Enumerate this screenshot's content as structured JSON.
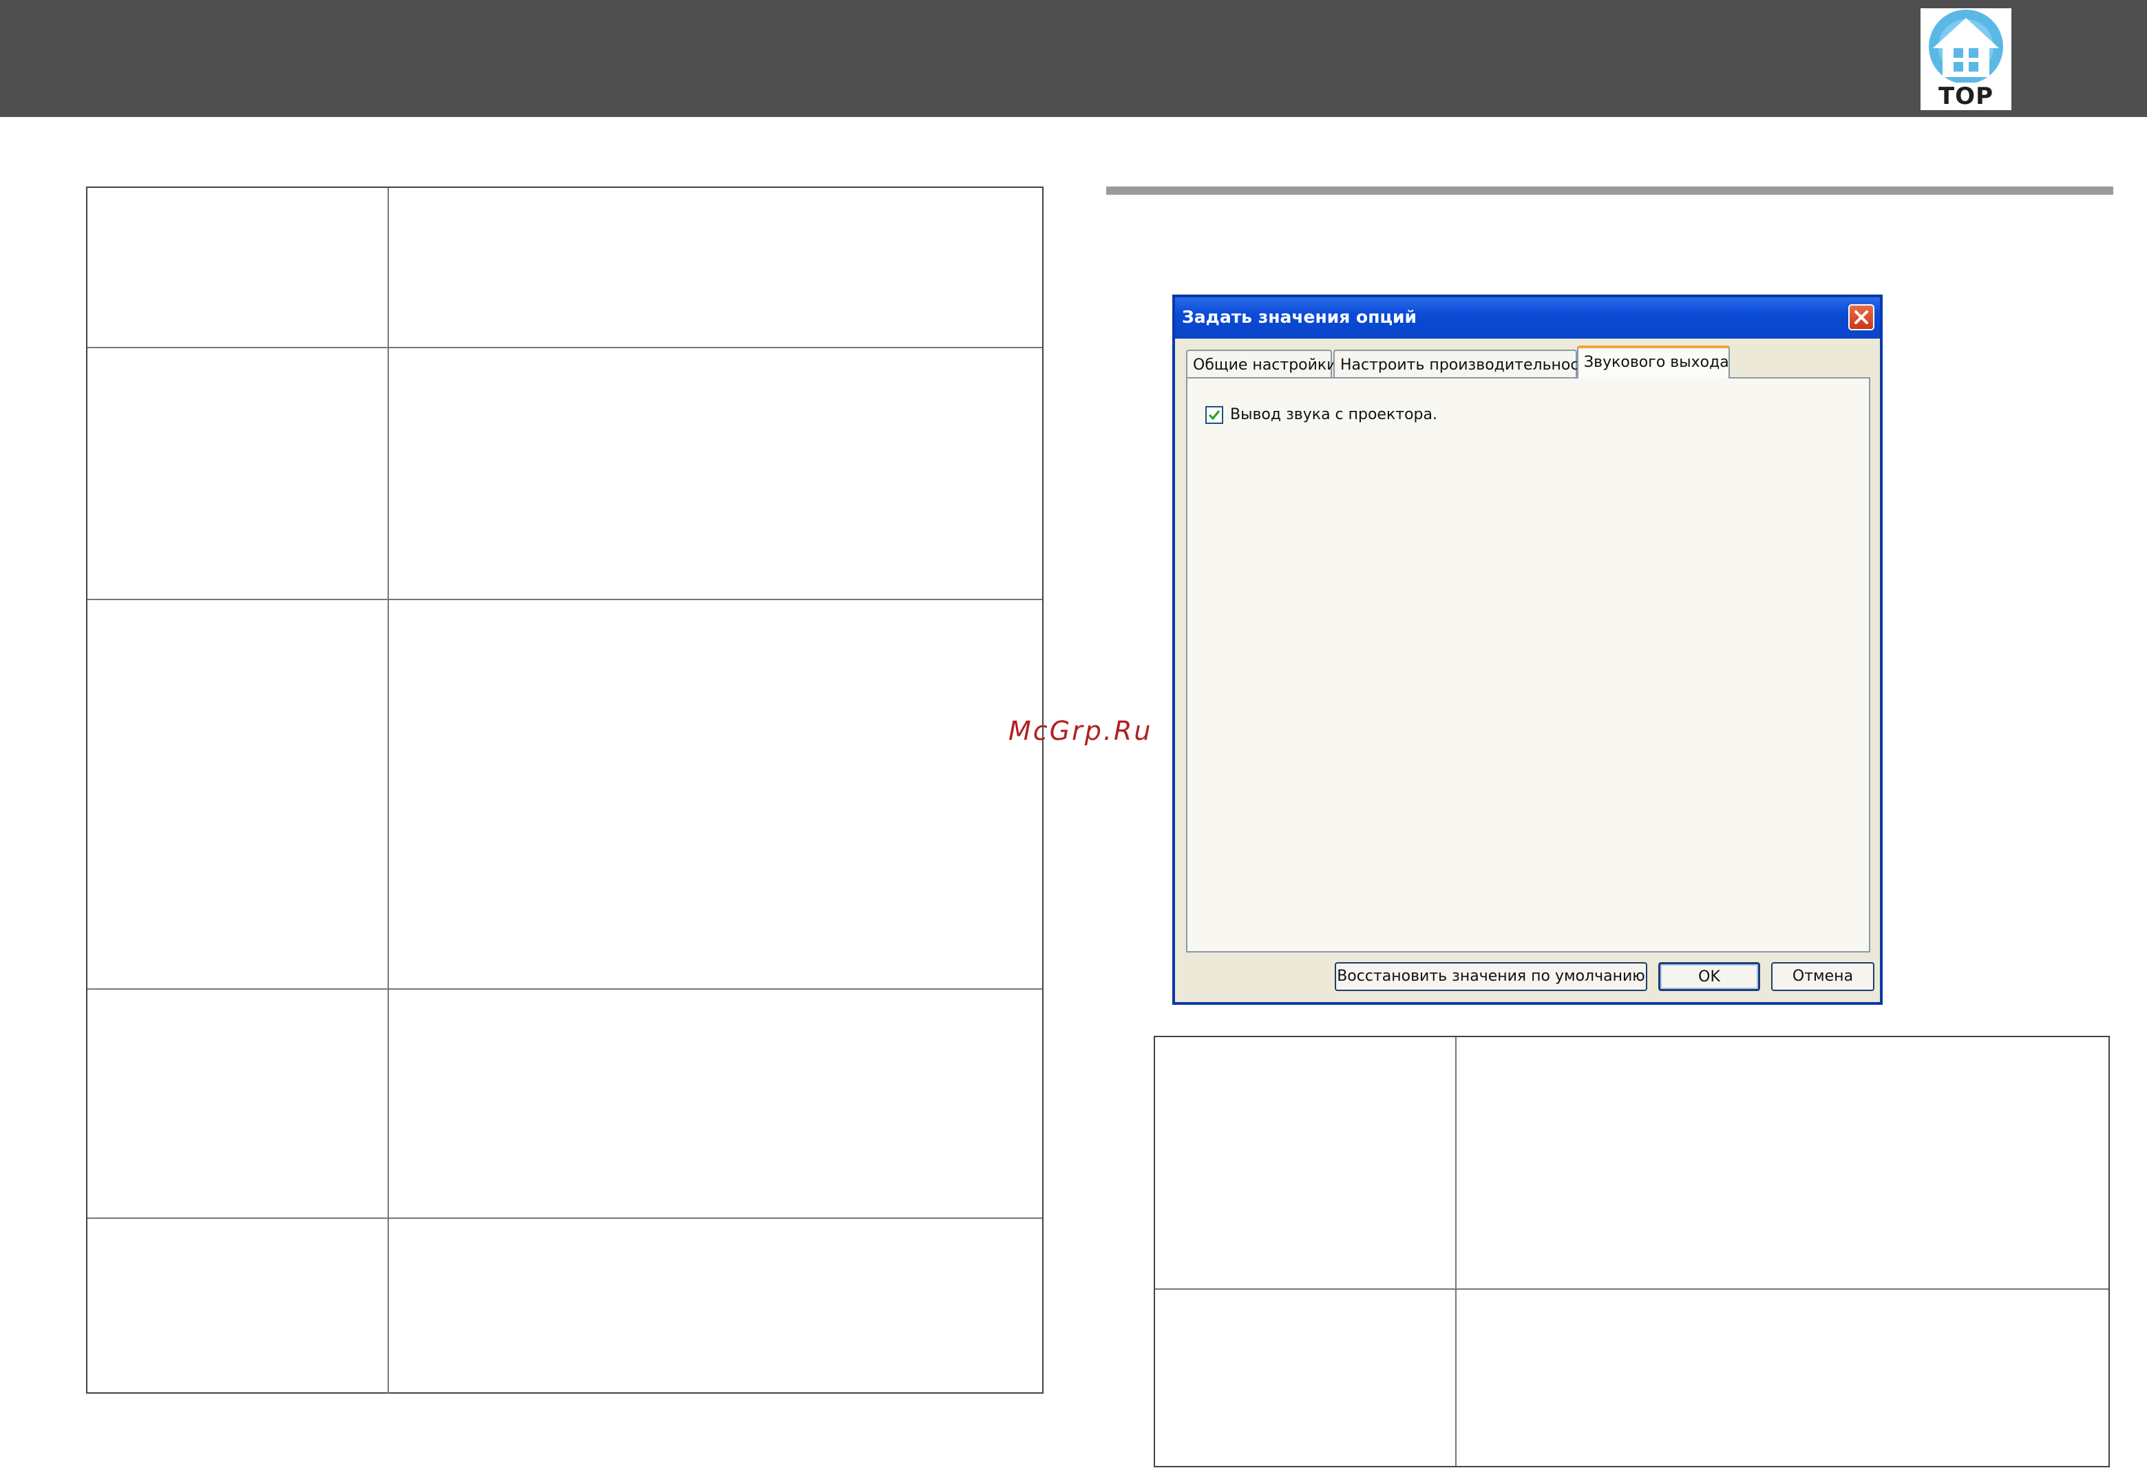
{
  "header": {
    "logo_text": "TOP",
    "colors": {
      "bar": "#4f4f4f",
      "logo_blue": "#5ab8e6"
    }
  },
  "watermark": "McGrp.Ru",
  "dialog": {
    "title": "Задать значения опций",
    "tabs": [
      {
        "label": "Общие настройки"
      },
      {
        "label": "Настроить производительность"
      },
      {
        "label": "Звукового выхода",
        "active": true
      }
    ],
    "checkbox": {
      "label": "Вывод звука с проектора.",
      "checked": true
    },
    "buttons": {
      "restore": "Восстановить значения по умолчанию",
      "ok": "OK",
      "cancel": "Отмена"
    }
  },
  "left_table": {
    "rows": 5
  },
  "right_table": {
    "rows": 2
  }
}
